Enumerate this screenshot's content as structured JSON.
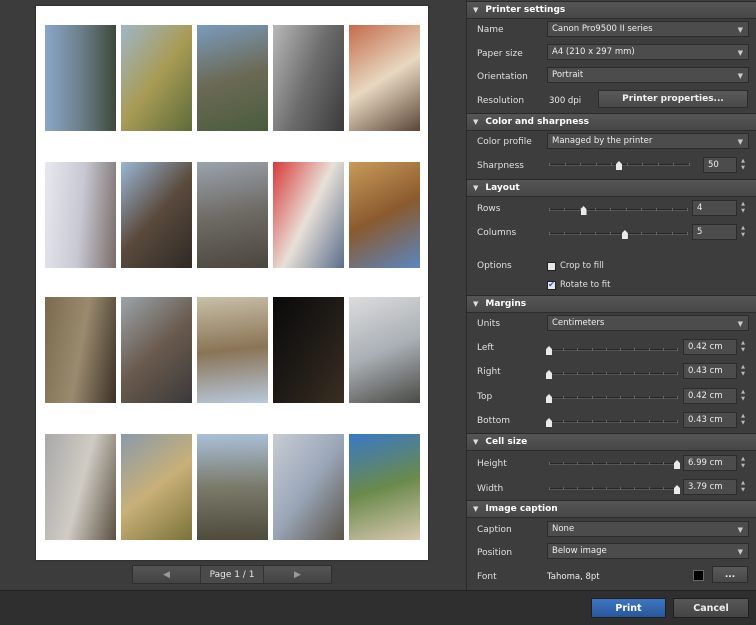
{
  "pager": {
    "prev_icon": "arrow-left-icon",
    "label": "Page 1 / 1",
    "next_icon": "arrow-right-icon"
  },
  "sections": {
    "printer": {
      "title": "Printer settings"
    },
    "color": {
      "title": "Color and sharpness"
    },
    "layout": {
      "title": "Layout"
    },
    "margins": {
      "title": "Margins"
    },
    "cell": {
      "title": "Cell size"
    },
    "caption": {
      "title": "Image caption"
    }
  },
  "printer": {
    "name_label": "Name",
    "name_value": "Canon Pro9500 II series",
    "paper_label": "Paper size",
    "paper_value": "A4 (210 x 297 mm)",
    "orientation_label": "Orientation",
    "orientation_value": "Portrait",
    "resolution_label": "Resolution",
    "resolution_value": "300 dpi",
    "properties_button": "Printer properties..."
  },
  "color": {
    "profile_label": "Color profile",
    "profile_value": "Managed by the printer",
    "sharpness_label": "Sharpness",
    "sharpness_value": "50",
    "sharpness_level": 0.5
  },
  "layout": {
    "rows_label": "Rows",
    "rows_value": "4",
    "rows_level": 0.25,
    "columns_label": "Columns",
    "columns_value": "5",
    "columns_level": 0.55,
    "options_label": "Options",
    "crop_label": "Crop to fill",
    "crop_checked": false,
    "rotate_label": "Rotate to fit",
    "rotate_checked": true
  },
  "margins": {
    "units_label": "Units",
    "units_value": "Centimeters",
    "left_label": "Left",
    "left_value": "0.42 cm",
    "right_label": "Right",
    "right_value": "0.43 cm",
    "top_label": "Top",
    "top_value": "0.42 cm",
    "bottom_label": "Bottom",
    "bottom_value": "0.43 cm"
  },
  "cell": {
    "height_label": "Height",
    "height_value": "6.99 cm",
    "width_label": "Width",
    "width_value": "3.79 cm"
  },
  "caption": {
    "caption_label": "Caption",
    "caption_value": "None",
    "position_label": "Position",
    "position_value": "Below image",
    "font_label": "Font",
    "font_value": "Tahoma, 8pt",
    "font_color": "#000000",
    "font_button": "..."
  },
  "actions": {
    "print": "Print",
    "cancel": "Cancel"
  },
  "colors": {
    "accent": "#2f62aa",
    "panel_bg": "#3d3d3d",
    "header_bg": "#4f4f4f"
  },
  "thumbnails": [
    "mountain-lake-photo",
    "hillside-lake-photo",
    "lakeside-town-photo",
    "road-bridge-photo",
    "painted-face-portrait-photo",
    "snow-child-photo",
    "cathedral-tower-photo",
    "old-town-bridge-photo",
    "red-umbrella-sculpture-photo",
    "yellow-building-photo",
    "arched-alley-photo",
    "facade-windows-photo",
    "tiled-roofs-photo",
    "night-window-photo",
    "bare-trees-facade-photo",
    "bare-tree-hills-photo",
    "grassy-hills-photo",
    "mountain-sky-photo",
    "clouds-valley-photo",
    "palm-terrace-photo"
  ]
}
